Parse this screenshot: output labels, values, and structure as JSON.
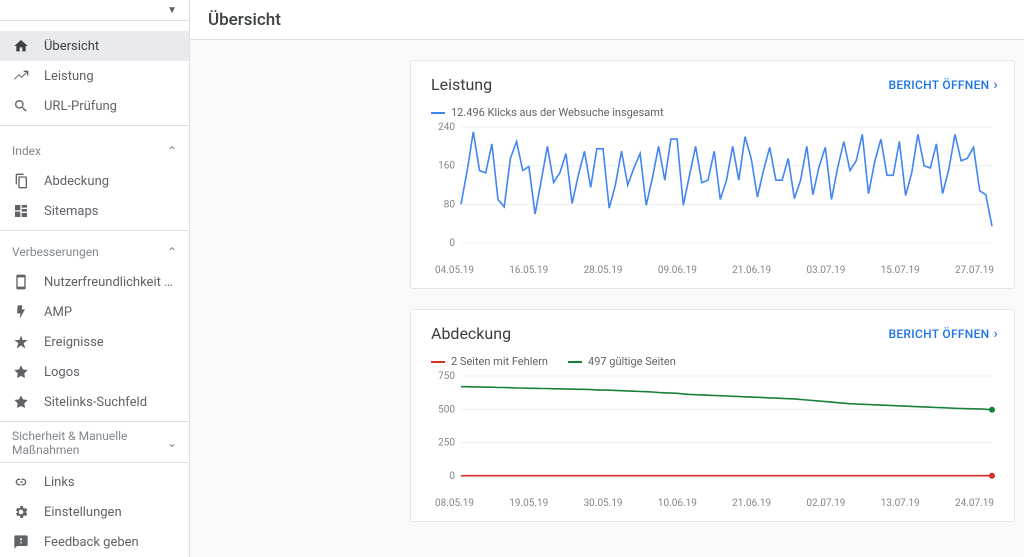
{
  "page_title": "Übersicht",
  "sidebar": {
    "main": [
      {
        "label": "Übersicht",
        "icon": "home-icon",
        "active": true
      },
      {
        "label": "Leistung",
        "icon": "performance-icon"
      },
      {
        "label": "URL-Prüfung",
        "icon": "inspect-icon"
      }
    ],
    "sections": [
      {
        "title": "Index",
        "items": [
          {
            "label": "Abdeckung",
            "icon": "coverage-icon"
          },
          {
            "label": "Sitemaps",
            "icon": "sitemaps-icon"
          }
        ]
      },
      {
        "title": "Verbesserungen",
        "items": [
          {
            "label": "Nutzerfreundlichkeit auf Mo…",
            "icon": "mobile-icon"
          },
          {
            "label": "AMP",
            "icon": "amp-icon"
          },
          {
            "label": "Ereignisse",
            "icon": "events-icon"
          },
          {
            "label": "Logos",
            "icon": "logos-icon"
          },
          {
            "label": "Sitelinks-Suchfeld",
            "icon": "sitelinks-icon"
          }
        ]
      },
      {
        "title": "Sicherheit & Manuelle Maßnahmen",
        "collapsed": true,
        "items": []
      }
    ],
    "footer": [
      {
        "label": "Links",
        "icon": "links-icon"
      },
      {
        "label": "Einstellungen",
        "icon": "settings-icon"
      },
      {
        "label": "Feedback geben",
        "icon": "feedback-icon"
      }
    ]
  },
  "cards": {
    "performance": {
      "title": "Leistung",
      "open_label": "BERICHT ÖFFNEN",
      "legend": "12.496 Klicks aus der Websuche insgesamt",
      "color": "#4285f4"
    },
    "coverage": {
      "title": "Abdeckung",
      "open_label": "BERICHT ÖFFNEN",
      "legend_errors": "2 Seiten mit Fehlern",
      "legend_valid": "497 gültige Seiten",
      "color_errors": "#d93025",
      "color_valid": "#188038"
    }
  },
  "chart_data": [
    {
      "type": "line",
      "title": "Leistung",
      "ylabel": "",
      "xlabel": "",
      "ylim": [
        0,
        240
      ],
      "yticks": [
        0,
        80,
        160,
        240
      ],
      "x_labels": [
        "04.05.19",
        "16.05.19",
        "28.05.19",
        "09.06.19",
        "21.06.19",
        "03.07.19",
        "15.07.19",
        "27.07.19"
      ],
      "series": [
        {
          "name": "Klicks",
          "color": "#4285f4",
          "values": [
            80,
            150,
            230,
            150,
            145,
            205,
            90,
            75,
            175,
            210,
            150,
            158,
            60,
            130,
            200,
            125,
            145,
            185,
            82,
            140,
            190,
            115,
            195,
            195,
            72,
            120,
            190,
            120,
            155,
            185,
            78,
            135,
            200,
            130,
            215,
            215,
            78,
            140,
            200,
            125,
            130,
            190,
            90,
            130,
            200,
            130,
            220,
            175,
            95,
            150,
            198,
            130,
            130,
            175,
            92,
            130,
            200,
            100,
            158,
            198,
            90,
            155,
            210,
            150,
            170,
            225,
            102,
            168,
            215,
            140,
            140,
            210,
            98,
            145,
            225,
            160,
            155,
            205,
            102,
            152,
            225,
            170,
            175,
            198,
            108,
            100,
            35
          ]
        }
      ]
    },
    {
      "type": "line",
      "title": "Abdeckung",
      "ylabel": "",
      "xlabel": "",
      "ylim": [
        0,
        750
      ],
      "yticks": [
        0,
        250,
        500,
        750
      ],
      "x_labels": [
        "08.05.19",
        "19.05.19",
        "30.05.19",
        "10.06.19",
        "21.06.19",
        "02.07.19",
        "13.07.19",
        "24.07.19"
      ],
      "series": [
        {
          "name": "Fehler",
          "color": "#d93025",
          "values": [
            2,
            2,
            2,
            2,
            2,
            2,
            2,
            2,
            2,
            2,
            2,
            2,
            2,
            2,
            2,
            2,
            2,
            2,
            2,
            2,
            2,
            2,
            2,
            2,
            2,
            2,
            2,
            2,
            2,
            2,
            2,
            2,
            2,
            2,
            2,
            2,
            2,
            2,
            2,
            2,
            2,
            2,
            2,
            2,
            2,
            2,
            2,
            2,
            2,
            2,
            2,
            2,
            2,
            2,
            2,
            2,
            2,
            2,
            2,
            2,
            2,
            2,
            2,
            2,
            2,
            2,
            2,
            2,
            2,
            2,
            2,
            2,
            2,
            2,
            2,
            2,
            2,
            2,
            2,
            2,
            2,
            2,
            2,
            2,
            2,
            2,
            2
          ]
        },
        {
          "name": "Gültig",
          "color": "#188038",
          "values": [
            670,
            670,
            668,
            668,
            666,
            666,
            664,
            664,
            662,
            660,
            660,
            658,
            658,
            656,
            656,
            654,
            654,
            652,
            652,
            650,
            650,
            648,
            646,
            644,
            644,
            642,
            640,
            638,
            636,
            634,
            632,
            630,
            626,
            624,
            622,
            620,
            616,
            612,
            610,
            608,
            606,
            604,
            602,
            600,
            598,
            596,
            594,
            592,
            590,
            588,
            586,
            584,
            582,
            580,
            578,
            574,
            570,
            566,
            562,
            558,
            554,
            550,
            546,
            542,
            540,
            538,
            536,
            534,
            532,
            530,
            528,
            526,
            524,
            522,
            520,
            518,
            516,
            514,
            512,
            510,
            508,
            506,
            505,
            504,
            503,
            500,
            497
          ]
        }
      ]
    }
  ]
}
